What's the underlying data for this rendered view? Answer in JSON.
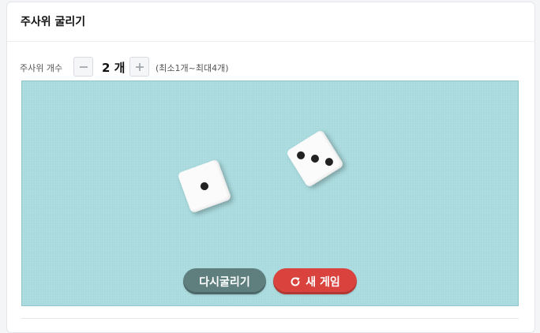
{
  "header": {
    "title": "주사위 굴리기"
  },
  "controls": {
    "label": "주사위 개수",
    "count": "2 개",
    "range_hint": "(최소1개~최대4개)"
  },
  "board": {
    "dice_values": [
      1,
      3
    ]
  },
  "actions": {
    "reroll_label": "다시굴리기",
    "new_game_label": "새 게임"
  },
  "colors": {
    "board_bg": "#a4d8dc",
    "reroll_button": "#5f7f7f",
    "new_game_button": "#d9423d"
  },
  "icons": {
    "decrease": "minus-icon",
    "increase": "plus-icon",
    "new_game": "refresh-icon"
  }
}
